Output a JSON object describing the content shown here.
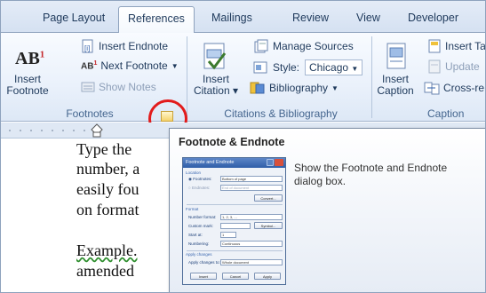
{
  "tabs": [
    "Page Layout",
    "References",
    "Mailings",
    "Review",
    "View",
    "Developer"
  ],
  "active_tab": "References",
  "footnotes": {
    "insert_footnote": [
      "Insert",
      "Footnote"
    ],
    "insert_endnote": "Insert Endnote",
    "next_footnote": "Next Footnote",
    "show_notes": "Show Notes",
    "group_label": "Footnotes"
  },
  "citations": {
    "insert_citation": [
      "Insert",
      "Citation"
    ],
    "manage_sources": "Manage Sources",
    "style_label": "Style:",
    "style_value": "Chicago",
    "bibliography": "Bibliography",
    "group_label": "Citations & Bibliography"
  },
  "captions": {
    "insert_caption": [
      "Insert",
      "Caption"
    ],
    "insert_table": "Insert Ta",
    "update": "Update",
    "cross_ref": "Cross-re",
    "group_label": "Caption"
  },
  "document_lines": [
    "Type the",
    "number, a",
    "easily fou",
    "on format",
    "",
    "Example.",
    "amended"
  ],
  "tooltip": {
    "title": "Footnote & Endnote",
    "description": "Show the Footnote and Endnote dialog box."
  },
  "dialog": {
    "title": "Footnote and Endnote",
    "location": "Location",
    "footnotes": "Footnotes:",
    "footnotes_value": "Bottom of page",
    "endnotes": "Endnotes:",
    "endnotes_value": "End of document",
    "convert": "Convert...",
    "format": "Format",
    "number_format": "Number format:",
    "number_format_value": "1, 2, 3, ...",
    "custom_mark": "Custom mark:",
    "symbol": "Symbol...",
    "start_at": "Start at:",
    "start_at_value": "1",
    "numbering": "Numbering:",
    "numbering_value": "Continuous",
    "apply_changes": "Apply changes",
    "apply_to": "Apply changes to:",
    "apply_to_value": "Whole document",
    "insert": "Insert",
    "cancel": "Cancel",
    "apply": "Apply"
  }
}
